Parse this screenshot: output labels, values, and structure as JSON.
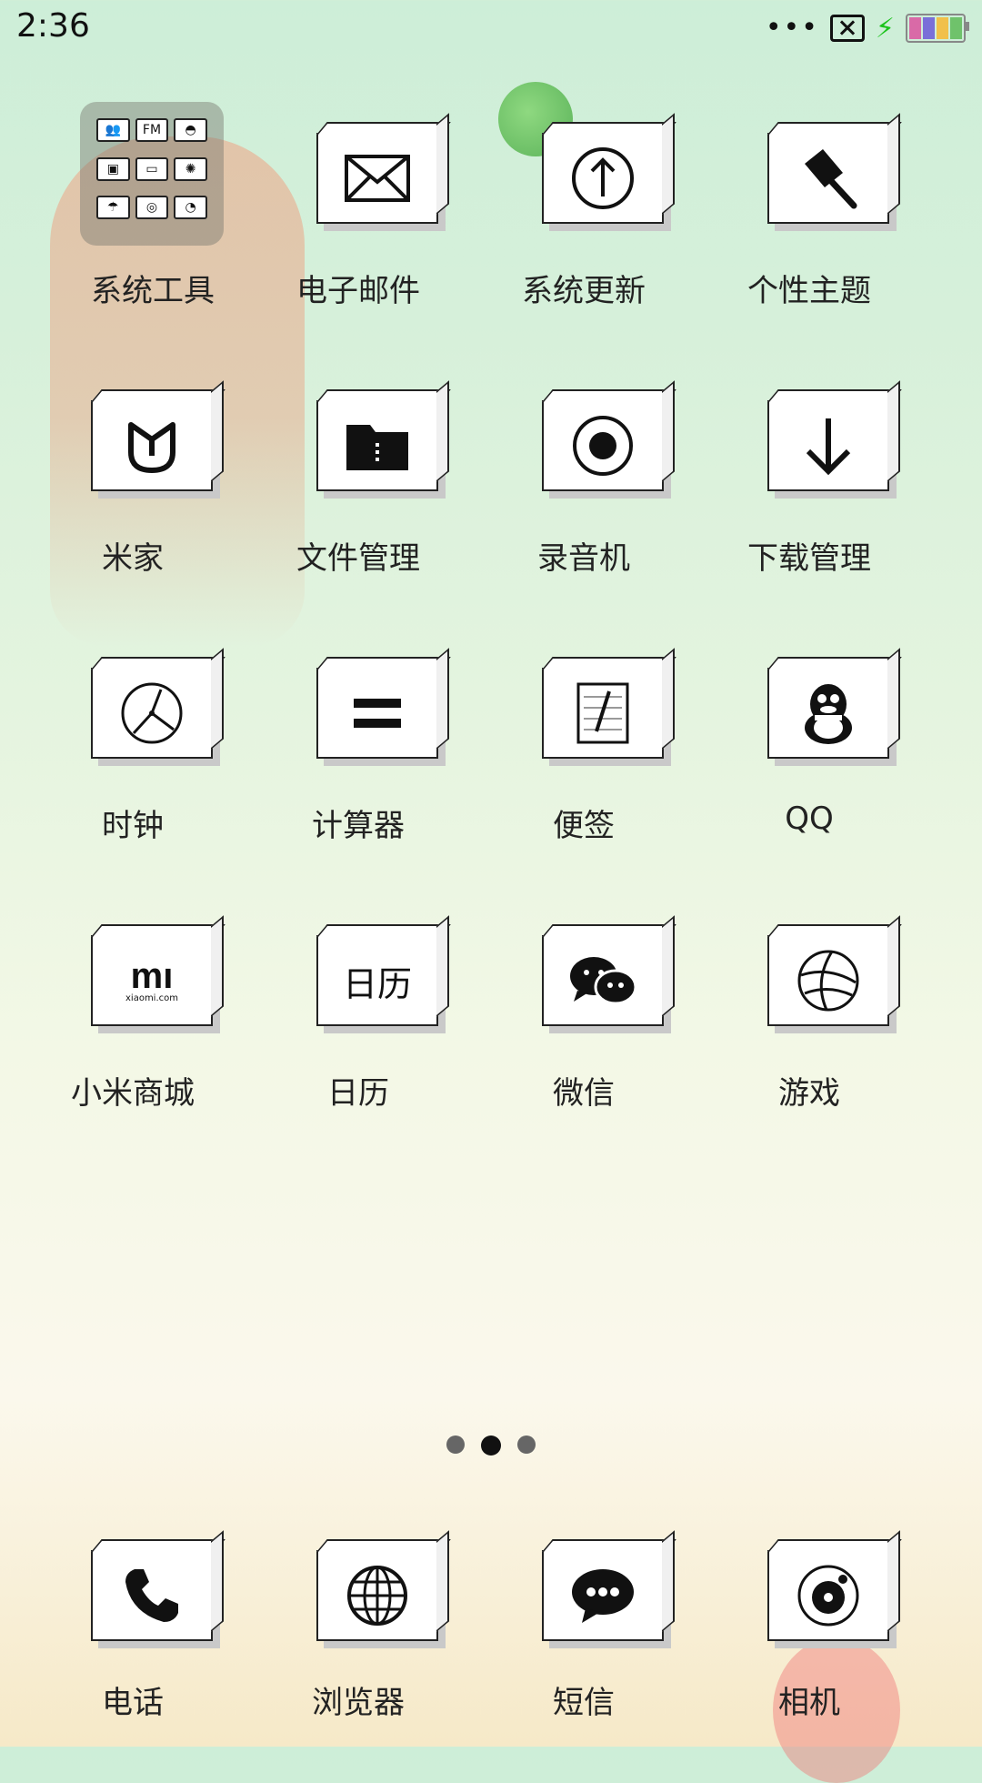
{
  "status_bar": {
    "time": "2:36",
    "battery_colors": [
      "#d96aa7",
      "#7a6fd8",
      "#f1c04a",
      "#6fc26b"
    ],
    "charging_color": "#1cc31c"
  },
  "folder": {
    "label": "系统工具",
    "mini_icons": [
      "people-icon",
      "fm-icon",
      "contrast-icon",
      "tv-icon",
      "photo-icon",
      "settings-icon",
      "umbrella-icon",
      "game-icon",
      "compass-icon"
    ]
  },
  "apps": [
    {
      "label": "电子邮件",
      "icon": "mail-icon"
    },
    {
      "label": "系统更新",
      "icon": "upload-arrow-icon"
    },
    {
      "label": "个性主题",
      "icon": "paint-brush-icon"
    },
    {
      "label": "米家",
      "icon": "mijia-icon"
    },
    {
      "label": "文件管理",
      "icon": "folder-icon"
    },
    {
      "label": "录音机",
      "icon": "record-icon"
    },
    {
      "label": "下载管理",
      "icon": "download-arrow-icon"
    },
    {
      "label": "时钟",
      "icon": "clock-icon"
    },
    {
      "label": "计算器",
      "icon": "equals-icon"
    },
    {
      "label": "便签",
      "icon": "note-icon"
    },
    {
      "label": "QQ",
      "icon": "penguin-icon"
    },
    {
      "label": "小米商城",
      "icon": "mi-store-icon"
    },
    {
      "label": "日历",
      "icon": "calendar-text-icon",
      "icon_text": "日历"
    },
    {
      "label": "微信",
      "icon": "wechat-icon"
    },
    {
      "label": "游戏",
      "icon": "ball-icon"
    }
  ],
  "mi_icon_text": "mı",
  "mi_icon_sub": "xiaomi.com",
  "pager": {
    "count": 3,
    "active": 1
  },
  "dock": [
    {
      "label": "电话",
      "icon": "phone-icon"
    },
    {
      "label": "浏览器",
      "icon": "globe-icon"
    },
    {
      "label": "短信",
      "icon": "message-icon"
    },
    {
      "label": "相机",
      "icon": "camera-icon"
    }
  ]
}
